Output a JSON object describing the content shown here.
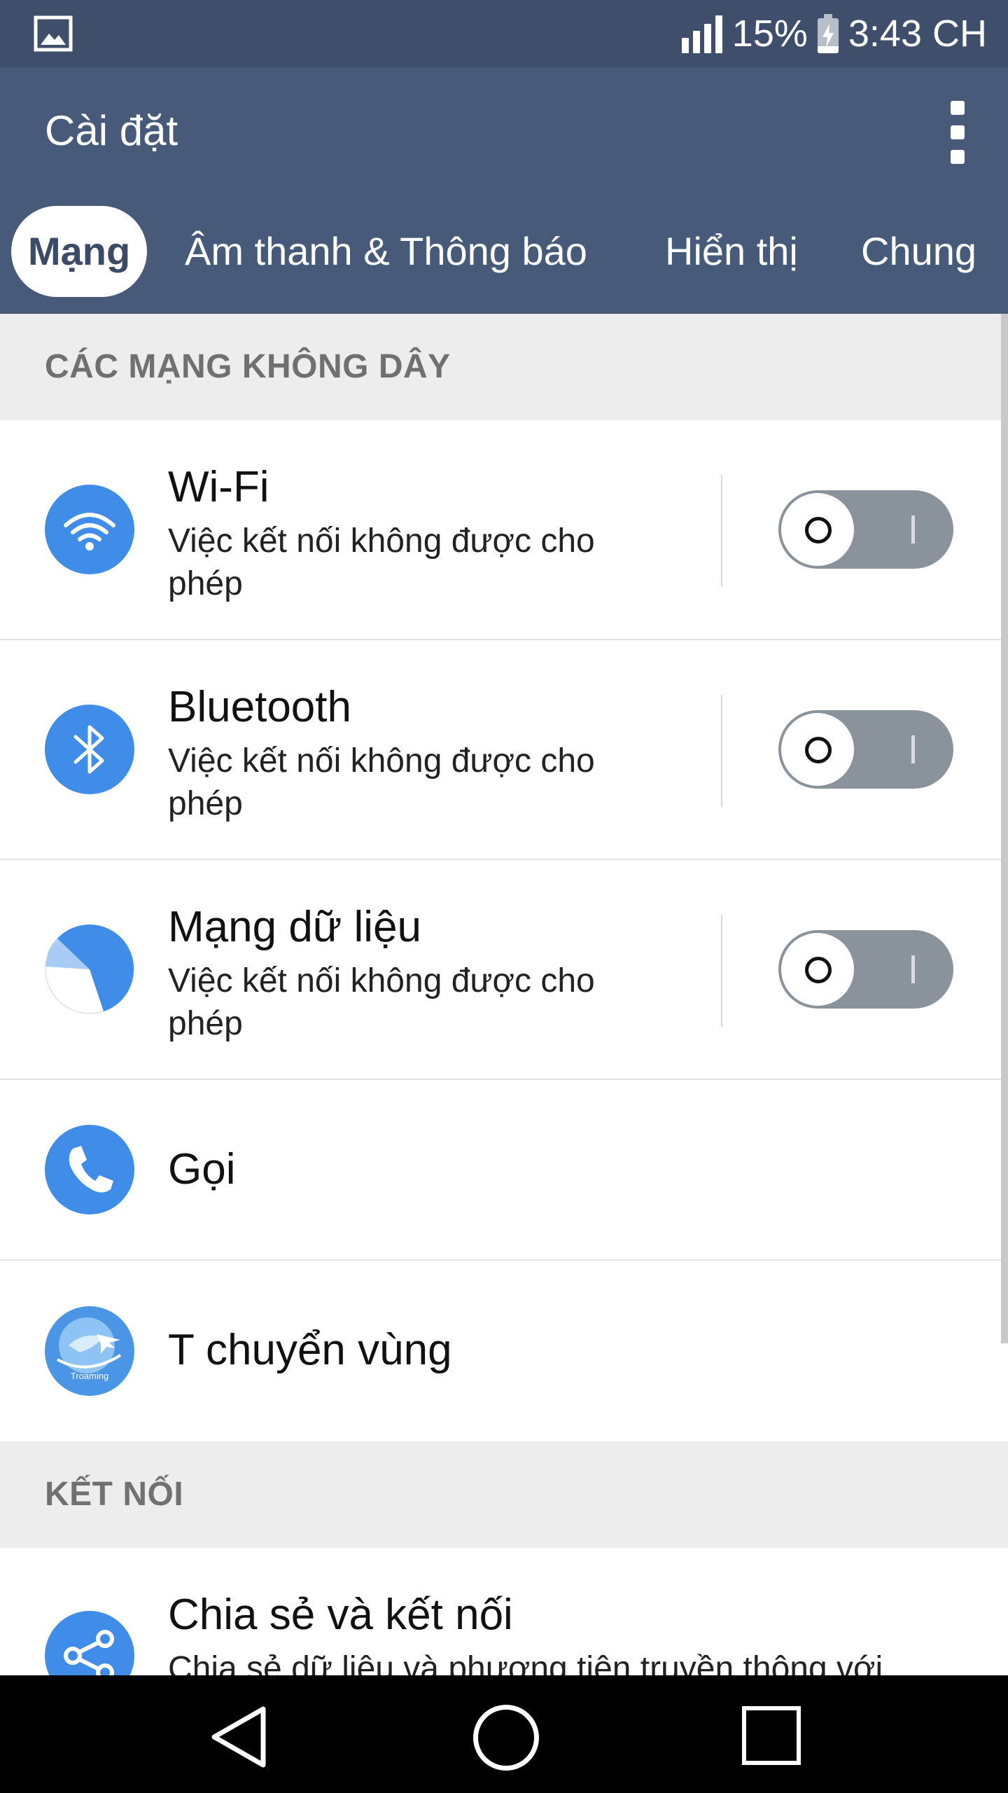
{
  "status_bar": {
    "battery_percent": "15%",
    "time": "3:43 CH"
  },
  "app_bar": {
    "title": "Cài đặt",
    "tabs": [
      {
        "label": "Mạng",
        "active": true
      },
      {
        "label": "Âm thanh & Thông báo",
        "active": false
      },
      {
        "label": "Hiển thị",
        "active": false
      },
      {
        "label": "Chung",
        "active": false
      }
    ]
  },
  "sections": [
    {
      "header": "CÁC MẠNG KHÔNG DÂY",
      "items": [
        {
          "title": "Wi-Fi",
          "subtitle": "Việc kết nối không được cho phép",
          "icon": "wifi-icon",
          "toggle_on": false
        },
        {
          "title": "Bluetooth",
          "subtitle": "Việc kết nối không được cho phép",
          "icon": "bluetooth-icon",
          "toggle_on": false
        },
        {
          "title": "Mạng dữ liệu",
          "subtitle": "Việc kết nối không được cho phép",
          "icon": "data-usage-icon",
          "toggle_on": false
        },
        {
          "title": "Gọi",
          "icon": "phone-icon"
        },
        {
          "title": "T chuyển vùng",
          "icon": "troaming-icon",
          "icon_label": "Troaming"
        }
      ]
    },
    {
      "header": "KẾT NỐI",
      "items": [
        {
          "title": "Chia sẻ và kết nối",
          "subtitle": "Chia sẻ dữ liệu và phương tiện truyền thông với",
          "icon": "share-icon"
        }
      ]
    }
  ],
  "colors": {
    "status_bar": "#3f4f6b",
    "app_bar": "#475a7a",
    "accent_icon": "#3f8de8",
    "toggle_off": "#8a929c",
    "section_bg": "#ededed"
  }
}
